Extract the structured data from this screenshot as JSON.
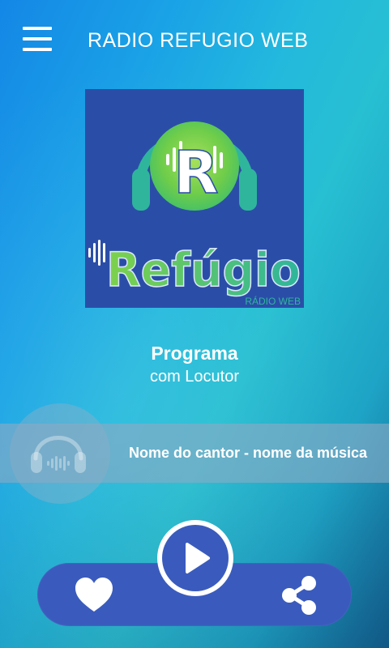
{
  "header": {
    "title": "RADIO REFUGIO WEB",
    "menu_icon": "hamburger-menu-icon"
  },
  "logo": {
    "letter": "R",
    "brand": "Refúgio",
    "tagline": "RÁDIO WEB",
    "icon": "headphones-logo"
  },
  "program": {
    "title": "Programa",
    "subtitle": "com Locutor"
  },
  "now_playing": {
    "text": "Nome do cantor - nome da música",
    "icon": "headphones-icon"
  },
  "controls": {
    "play_icon": "play-icon",
    "favorite_icon": "heart-icon",
    "share_icon": "share-icon"
  },
  "colors": {
    "control_bar": "#3a5bbd",
    "logo_background": "#2a4ea8",
    "logo_green": "#7ed24a",
    "logo_teal": "#2fb59c"
  }
}
